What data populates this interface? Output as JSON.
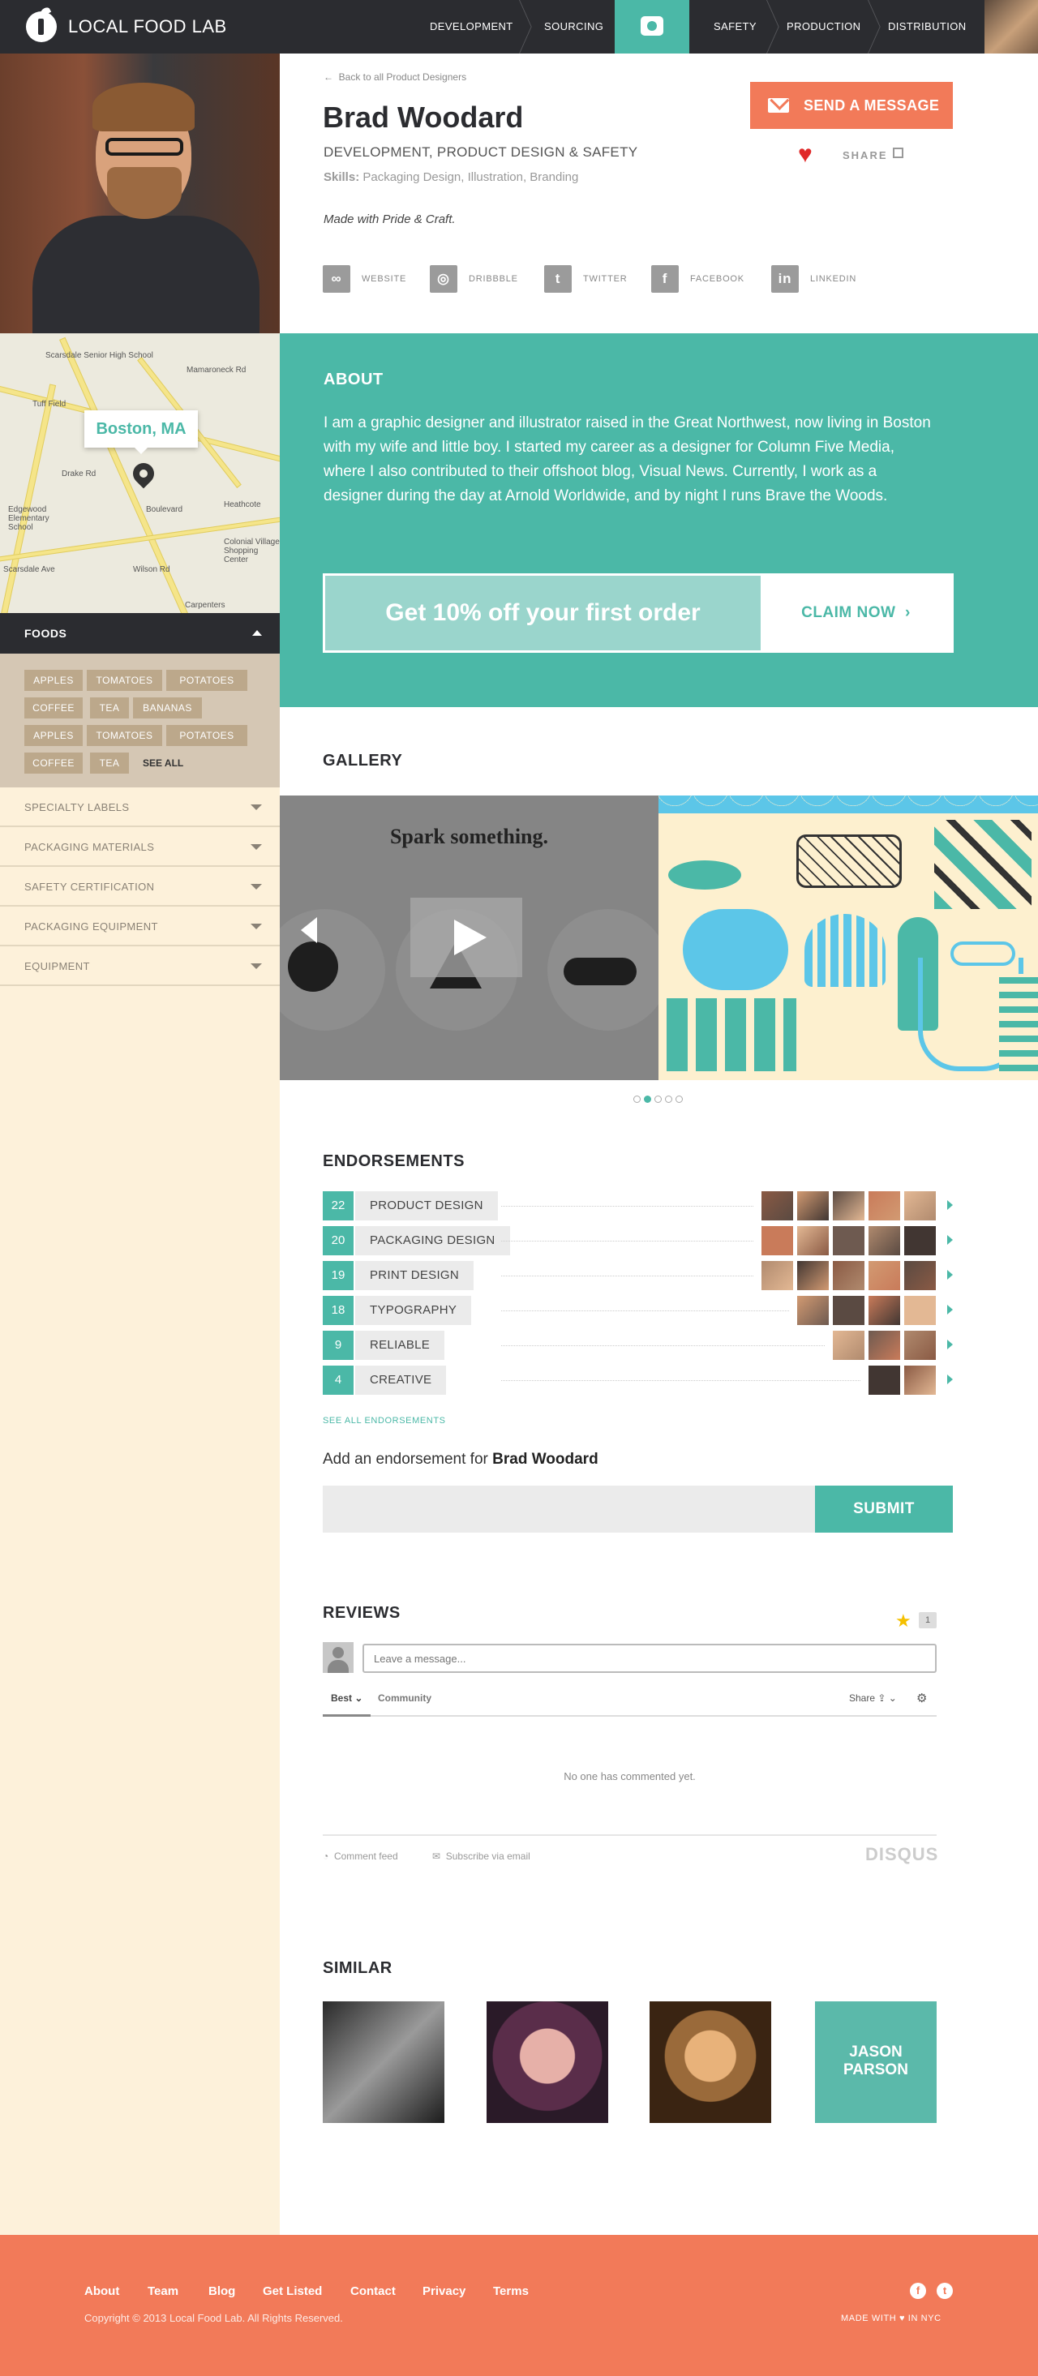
{
  "nav": {
    "brand": "LOCAL FOOD LAB",
    "items": [
      "DEVELOPMENT",
      "SOURCING",
      "SAFETY",
      "PRODUCTION",
      "DISTRIBUTION"
    ]
  },
  "sidebar": {
    "map_location": "Boston, MA",
    "map_labels": [
      "Scarsdale Senior High School",
      "Tuff Field",
      "Edgewood Elementary School",
      "Heathcote",
      "Colonial Village Shopping Center",
      "Carpenters",
      "Drake Rd",
      "Boulevard",
      "Wilson Rd",
      "Scarsdale Ave",
      "Mamaroneck Rd"
    ],
    "foods_title": "FOODS",
    "food_tags": [
      "APPLES",
      "TOMATOES",
      "POTATOES",
      "COFFEE",
      "TEA",
      "BANANAS",
      "APPLES",
      "TOMATOES",
      "POTATOES",
      "COFFEE",
      "TEA"
    ],
    "see_all": "SEE ALL",
    "accordions": [
      "SPECIALTY LABELS",
      "PACKAGING MATERIALS",
      "SAFETY CERTIFICATION",
      "PACKAGING EQUIPMENT",
      "EQUIPMENT"
    ]
  },
  "profile": {
    "back_link": "Back to all Product Designers",
    "name": "Brad Woodard",
    "roles": "DEVELOPMENT, PRODUCT DESIGN & SAFETY",
    "skills_label": "Skills:",
    "skills": "Packaging Design, Illustration, Branding",
    "motto": "Made with Pride & Craft.",
    "send_message": "SEND A MESSAGE",
    "share": "SHARE",
    "social": [
      "WEBSITE",
      "DRIBBBLE",
      "TWITTER",
      "FACEBOOK",
      "LINKEDIN"
    ]
  },
  "about": {
    "title": "ABOUT",
    "text": "I am a graphic designer and illustrator raised in the Great Northwest, now living in Boston with my wife and little boy. I started my career as a designer for Column Five Media, where I also contributed to their offshoot blog, Visual News. Currently, I work as a designer during the day at Arnold Worldwide, and by night I runs Brave the Woods.",
    "promo": "Get 10% off your first order",
    "promo_cta": "CLAIM NOW"
  },
  "gallery": {
    "title": "GALLERY",
    "slide_caption": "Spark something.",
    "dots": 5,
    "active_dot": 1
  },
  "endorsements": {
    "title": "ENDORSEMENTS",
    "rows": [
      {
        "count": "22",
        "label": "PRODUCT DESIGN",
        "avatars": 5
      },
      {
        "count": "20",
        "label": "PACKAGING DESIGN",
        "avatars": 5
      },
      {
        "count": "19",
        "label": "PRINT DESIGN",
        "avatars": 5
      },
      {
        "count": "18",
        "label": "TYPOGRAPHY",
        "avatars": 4
      },
      {
        "count": "9",
        "label": "RELIABLE",
        "avatars": 3
      },
      {
        "count": "4",
        "label": "CREATIVE",
        "avatars": 2
      }
    ],
    "see_all": "SEE ALL ENDORSEMENTS",
    "add_prefix": "Add an endorsement for",
    "add_name": "Brad Woodard",
    "submit": "SUBMIT"
  },
  "reviews": {
    "title": "REVIEWS",
    "star_count": "1",
    "placeholder": "Leave a message...",
    "tab_best": "Best",
    "tab_community": "Community",
    "share": "Share",
    "empty": "No one has commented yet.",
    "comment_feed": "Comment feed",
    "subscribe": "Subscribe via email",
    "brand": "DISQUS"
  },
  "similar": {
    "title": "SIMILAR",
    "tile_text": "JASON PARSON"
  },
  "footer": {
    "links": [
      "About",
      "Team",
      "Blog",
      "Get Listed",
      "Contact",
      "Privacy",
      "Terms"
    ],
    "copyright": "Copyright © 2013 Local Food Lab. All Rights Reserved.",
    "made_with_prefix": "MADE WITH",
    "made_with_suffix": "IN NYC"
  },
  "colors": {
    "teal": "#4bb8a7",
    "coral": "#f27a59",
    "dark": "#2b2c30",
    "cream": "#fdf1da"
  }
}
